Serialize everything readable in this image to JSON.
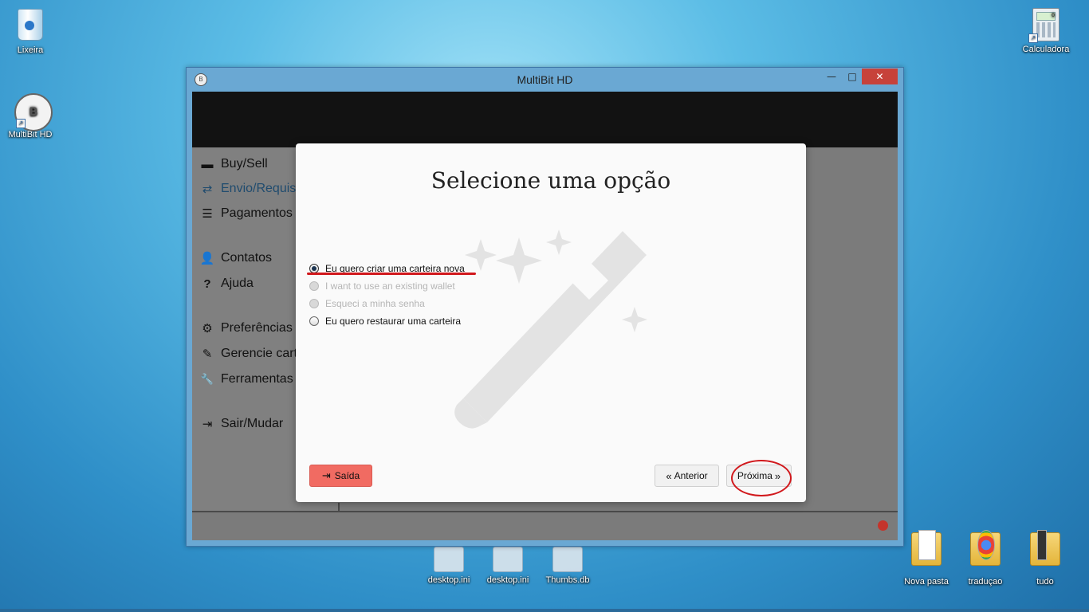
{
  "desktop": {
    "icons": {
      "recycle_bin": "Lixeira",
      "multibit": "MultiBit HD",
      "calculator": "Calculadora",
      "calculator_display": "0",
      "desktop_ini_1": "desktop.ini",
      "desktop_ini_2": "desktop.ini",
      "thumbs_db": "Thumbs.db",
      "nova_pasta": "Nova pasta",
      "traducao": "traduçao",
      "tudo": "tudo"
    }
  },
  "window": {
    "title": "MultiBit HD",
    "controls": {
      "minimize": "—",
      "maximize": "□",
      "close": "✕"
    }
  },
  "sidebar": {
    "items": [
      {
        "label": "Buy/Sell",
        "icon": "credit-card-icon",
        "glyph": "▬"
      },
      {
        "label": "Envio/Requisi",
        "icon": "exchange-icon",
        "glyph": "⇄"
      },
      {
        "label": "Pagamentos",
        "icon": "list-icon",
        "glyph": "☰"
      },
      {
        "label": "Contatos",
        "icon": "user-icon",
        "glyph": "👤"
      },
      {
        "label": "Ajuda",
        "icon": "question-icon",
        "glyph": "?"
      },
      {
        "label": "Preferências",
        "icon": "gears-icon",
        "glyph": "⚙"
      },
      {
        "label": "Gerencie cart",
        "icon": "edit-icon",
        "glyph": "✎"
      },
      {
        "label": "Ferramentas",
        "icon": "wrench-icon",
        "glyph": "🔧"
      },
      {
        "label": "Sair/Mudar",
        "icon": "sign-out-icon",
        "glyph": "⇥"
      }
    ]
  },
  "modal": {
    "title": "Selecione uma opção",
    "options": [
      {
        "label": "Eu quero criar uma carteira nova",
        "selected": true,
        "enabled": true
      },
      {
        "label": "I want to use an existing wallet",
        "selected": false,
        "enabled": false
      },
      {
        "label": "Esqueci a minha senha",
        "selected": false,
        "enabled": false
      },
      {
        "label": "Eu quero restaurar uma carteira",
        "selected": false,
        "enabled": true
      }
    ],
    "buttons": {
      "exit": "Saída",
      "previous": "Anterior",
      "next": "Próxima"
    },
    "icons": {
      "exit": "⇥",
      "previous": "«",
      "next": "»"
    }
  },
  "colors": {
    "accent_exit": "#f16b62",
    "status_dot": "#c4342b",
    "annotation": "#d1181c"
  }
}
